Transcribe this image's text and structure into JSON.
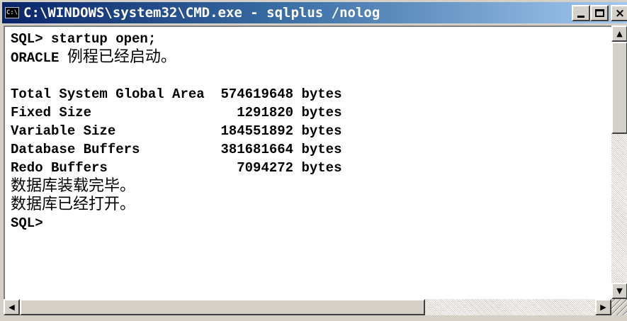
{
  "window": {
    "icon_text": "C:\\",
    "title": "C:\\WINDOWS\\system32\\CMD.exe - sqlplus /nolog",
    "buttons": {
      "minimize": "minimize",
      "maximize": "maximize",
      "close": "×"
    }
  },
  "console": {
    "lines": [
      "SQL> startup open;",
      "ORACLE ",
      "例程已经启动。",
      "",
      "Total System Global Area  574619648 bytes",
      "Fixed Size                  1291820 bytes",
      "Variable Size             184551892 bytes",
      "Database Buffers          381681664 bytes",
      "Redo Buffers                7094272 bytes",
      "数据库装载完毕。",
      "数据库已经打开。",
      "SQL>"
    ]
  },
  "scrollbars": {
    "vertical": {
      "up_arrow": "▲",
      "down_arrow": "▼"
    },
    "horizontal": {
      "left_arrow": "◀",
      "right_arrow": "▶"
    }
  }
}
